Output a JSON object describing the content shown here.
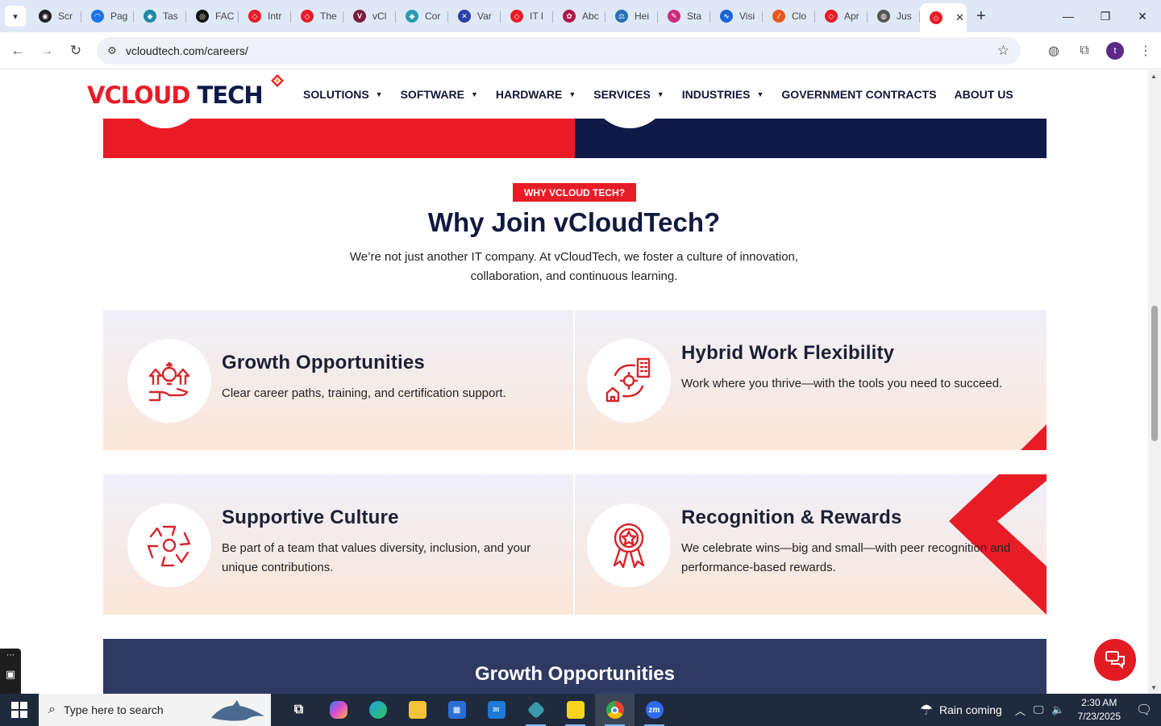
{
  "browser": {
    "tabs": [
      {
        "label": "Scr",
        "fav_color": "#202124",
        "fav_glyph": "◉"
      },
      {
        "label": "Pag",
        "fav_color": "#1a73e8",
        "fav_glyph": "◠"
      },
      {
        "label": "Tas",
        "fav_color": "#1b8aa6",
        "fav_glyph": "◆"
      },
      {
        "label": "FAC",
        "fav_color": "#111111",
        "fav_glyph": "◎"
      },
      {
        "label": "Intr",
        "fav_color": "#e81c27",
        "fav_glyph": "◇"
      },
      {
        "label": "The",
        "fav_color": "#e81c27",
        "fav_glyph": "◇"
      },
      {
        "label": "vCl",
        "fav_color": "#7a1e3c",
        "fav_glyph": "V"
      },
      {
        "label": "Cor",
        "fav_color": "#2a9bb0",
        "fav_glyph": "◆"
      },
      {
        "label": "Var",
        "fav_color": "#2b3ea8",
        "fav_glyph": "✕"
      },
      {
        "label": "IT I",
        "fav_color": "#e81c27",
        "fav_glyph": "◇"
      },
      {
        "label": "Abc",
        "fav_color": "#b0174a",
        "fav_glyph": "✿"
      },
      {
        "label": "Hei",
        "fav_color": "#2a6eb8",
        "fav_glyph": "⚖"
      },
      {
        "label": "Sta",
        "fav_color": "#cc2a7a",
        "fav_glyph": "✎"
      },
      {
        "label": "Visi",
        "fav_color": "#1a66d6",
        "fav_glyph": "∿"
      },
      {
        "label": "Clo",
        "fav_color": "#e8571c",
        "fav_glyph": "∕"
      },
      {
        "label": "Apr",
        "fav_color": "#e81c27",
        "fav_glyph": "◇"
      },
      {
        "label": "Jus",
        "fav_color": "#555555",
        "fav_glyph": "◍"
      }
    ],
    "active_tab": {
      "fav_color": "#e81c27",
      "fav_glyph": "◇",
      "close": "✕"
    },
    "new_tab": "+",
    "url": "vcloudtech.com/careers/",
    "profile_initial": "t"
  },
  "site": {
    "logo_part1": "VCLOUD",
    "logo_part2": " TECH",
    "nav": [
      {
        "label": "SOLUTIONS",
        "dropdown": true
      },
      {
        "label": "SOFTWARE",
        "dropdown": true
      },
      {
        "label": "HARDWARE",
        "dropdown": true
      },
      {
        "label": "SERVICES",
        "dropdown": true
      },
      {
        "label": "INDUSTRIES",
        "dropdown": true
      },
      {
        "label": "GOVERNMENT CONTRACTS",
        "dropdown": false
      },
      {
        "label": "ABOUT US",
        "dropdown": false
      }
    ]
  },
  "why": {
    "badge": "WHY VCLOUD TECH?",
    "heading": "Why Join vCloudTech?",
    "intro": "We’re not just another IT company. At vCloudTech, we foster a culture of innovation, collaboration, and continuous learning."
  },
  "cards": [
    {
      "title": "Growth Opportunities",
      "desc": "Clear career paths, training, and certification support.",
      "icon": "growth-icon"
    },
    {
      "title": "Hybrid Work Flexibility",
      "desc": "Work where you thrive—with the tools you need to succeed.",
      "icon": "hybrid-work-icon"
    },
    {
      "title": "Supportive Culture",
      "desc": "Be part of a team that values diversity, inclusion, and your unique contributions.",
      "icon": "culture-icon"
    },
    {
      "title": "Recognition & Rewards",
      "desc": "We celebrate wins—big and small—with peer recognition and performance-based rewards.",
      "icon": "award-ribbon-icon"
    }
  ],
  "growth_band": {
    "title": "Growth Opportunities"
  },
  "colors": {
    "brand_red": "#e81c27",
    "brand_navy": "#0f1a48",
    "band": "#2f3a62"
  },
  "taskbar": {
    "search_placeholder": "Type here to search",
    "weather": "Rain coming",
    "time": "2:30 AM",
    "date": "7/23/2025"
  }
}
